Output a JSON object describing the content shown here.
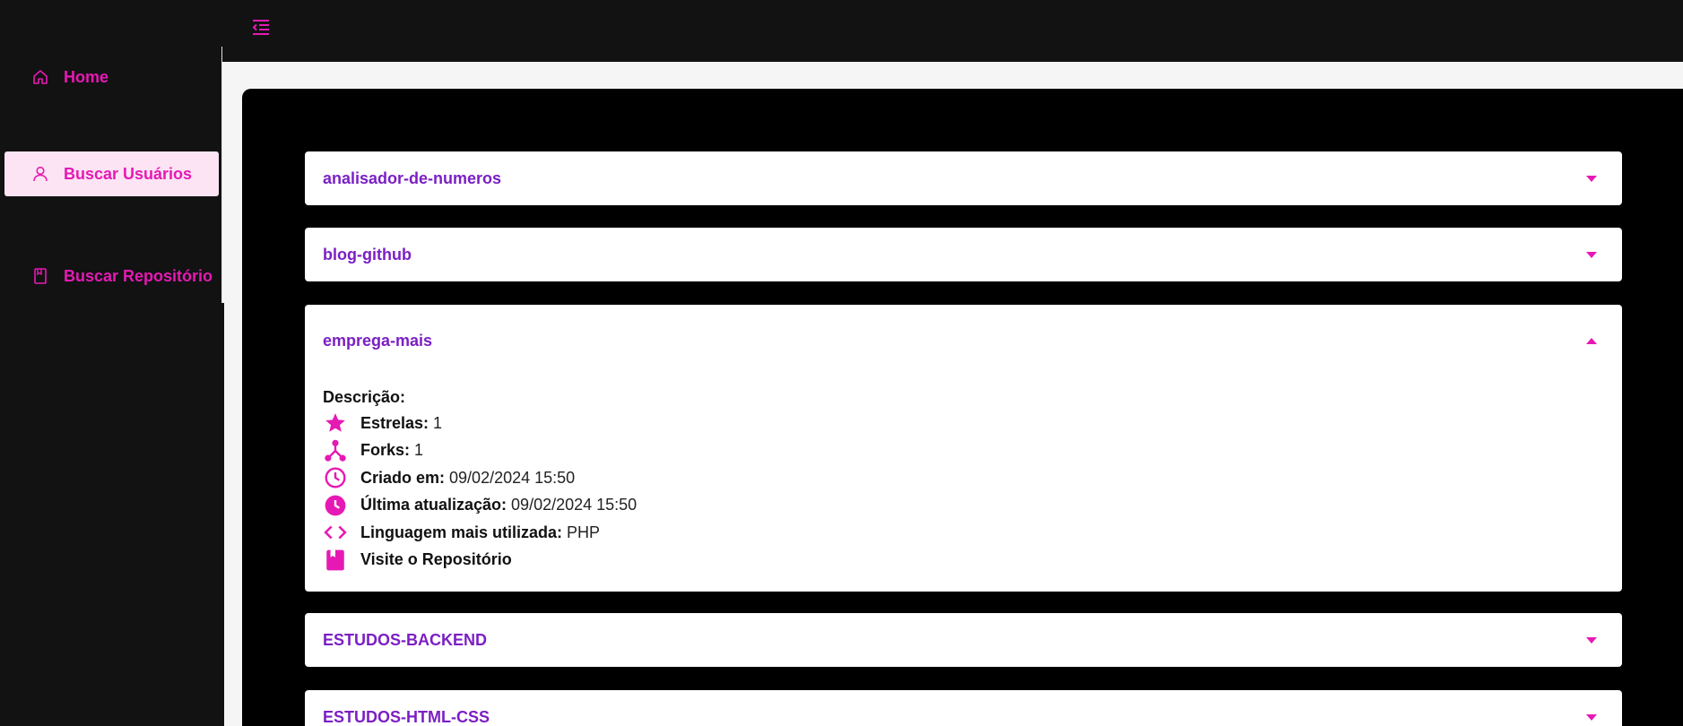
{
  "sidebar": {
    "items": [
      {
        "label": "Home",
        "icon": "home-icon",
        "active": false
      },
      {
        "label": "Buscar Usuários",
        "icon": "user-icon",
        "active": true
      },
      {
        "label": "Buscar Repositório",
        "icon": "book-icon",
        "active": false
      }
    ]
  },
  "topbar": {
    "menu_icon": "menu-collapse-icon"
  },
  "colors": {
    "accent": "#e619b4",
    "title": "#7b1fc4",
    "dark": "#121212",
    "active_bg": "#fce4f4"
  },
  "repos": [
    {
      "name": "analisador-de-numeros",
      "expanded": false
    },
    {
      "name": "blog-github",
      "expanded": false
    },
    {
      "name": "emprega-mais",
      "expanded": true,
      "details": {
        "description_label": "Descrição:",
        "stars_label": "Estrelas:",
        "stars": "1",
        "forks_label": "Forks:",
        "forks": "1",
        "created_label": "Criado em:",
        "created": "09/02/2024 15:50",
        "updated_label": "Última atualização:",
        "updated": "09/02/2024 15:50",
        "language_label": "Linguagem mais utilizada:",
        "language": "PHP",
        "visit_label": "Visite o Repositório"
      }
    },
    {
      "name": "ESTUDOS-BACKEND",
      "expanded": false
    },
    {
      "name": "ESTUDOS-HTML-CSS",
      "expanded": false
    }
  ]
}
